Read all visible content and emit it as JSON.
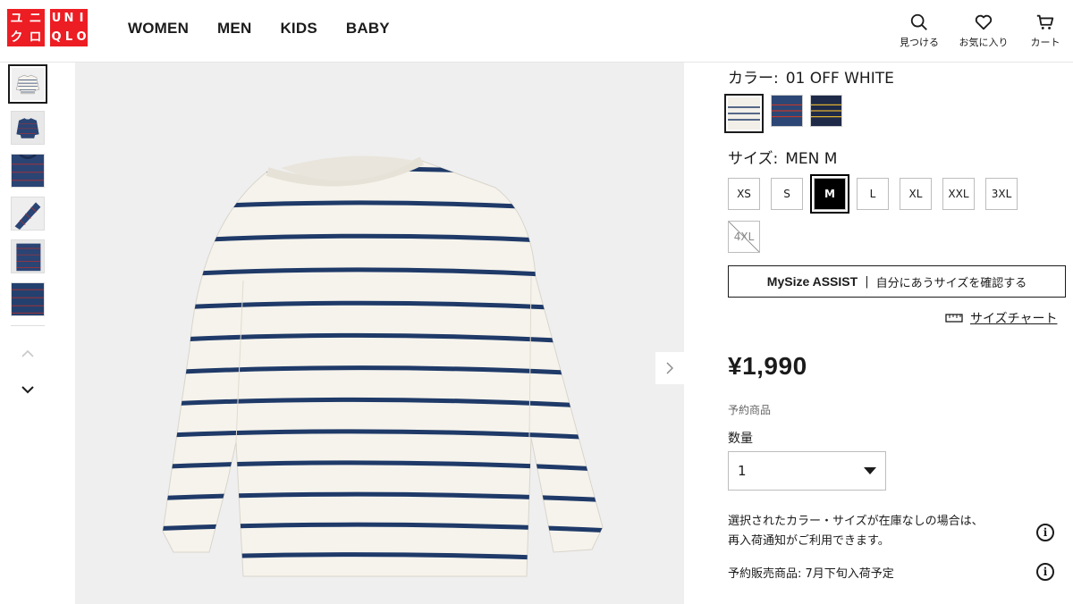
{
  "header": {
    "logo_top": [
      "ユ",
      "ニ",
      "ク",
      "ロ"
    ],
    "logo_bottom": [
      "U",
      "N",
      "I",
      "Q",
      "L",
      "O"
    ],
    "nav": [
      "WOMEN",
      "MEN",
      "KIDS",
      "BABY"
    ],
    "search_label": "見つける",
    "favorite_label": "お気に入り",
    "cart_label": "カート"
  },
  "product": {
    "color_key": "カラー:",
    "color_value": "01 OFF WHITE",
    "size_key": "サイズ:",
    "size_value": "MEN M",
    "colors": [
      {
        "name": "01 OFF WHITE",
        "bg": "#f2efe8",
        "stripe": "#1f3a68"
      },
      {
        "name": "navy-red",
        "bg": "#2c4775",
        "stripe": "#c0392b"
      },
      {
        "name": "navy-yellow",
        "bg": "#1e2a48",
        "stripe": "#e0b030"
      }
    ],
    "sizes": [
      {
        "label": "XS",
        "state": "available"
      },
      {
        "label": "S",
        "state": "available"
      },
      {
        "label": "M",
        "state": "selected"
      },
      {
        "label": "L",
        "state": "available"
      },
      {
        "label": "XL",
        "state": "available"
      },
      {
        "label": "XXL",
        "state": "available"
      },
      {
        "label": "3XL",
        "state": "available"
      },
      {
        "label": "4XL",
        "state": "unavailable"
      }
    ],
    "mysize_brand": "MySize ASSIST",
    "mysize_text": "自分にあうサイズを確認する",
    "size_chart": "サイズチャート",
    "price": "¥1,990",
    "preorder": "予約商品",
    "qty_label": "数量",
    "qty_value": "1",
    "notice_line1": "選択されたカラー・サイズが在庫なしの場合は、",
    "notice_line2": "再入荷通知がご利用できます。",
    "presale": "予約販売商品: 7月下旬入荷予定"
  },
  "colors": {
    "brand_red": "#ed1d24",
    "stripe_navy": "#1f3a68",
    "garment": "#f6f3ec"
  }
}
